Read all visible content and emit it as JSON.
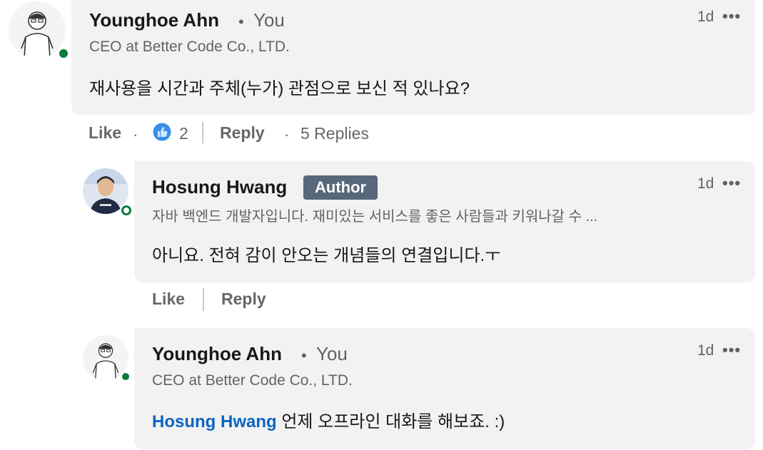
{
  "comment": {
    "author_name": "Younghoe Ahn",
    "you_label": "You",
    "headline": "CEO at Better Code Co., LTD.",
    "text": "재사용을 시간과 주체(누가) 관점으로 보신 적 있나요?",
    "time": "1d",
    "more": "•••",
    "actions": {
      "like": "Like",
      "reaction_count": "2",
      "reply": "Reply",
      "replies_count": "5 Replies"
    }
  },
  "reply1": {
    "author_name": "Hosung Hwang",
    "badge": "Author",
    "headline": "자바 백엔드 개발자입니다. 재미있는 서비스를 좋은 사람들과 키워나갈 수 ...",
    "text": "아니요. 전혀 감이 안오는 개념들의 연결입니다.ㅜ",
    "time": "1d",
    "more": "•••",
    "actions": {
      "like": "Like",
      "reply": "Reply"
    }
  },
  "reply2": {
    "author_name": "Younghoe Ahn",
    "you_label": "You",
    "headline": "CEO at Better Code Co., LTD.",
    "mention": "Hosung Hwang",
    "text": " 언제 오프라인 대화를 해보죠. :)",
    "time": "1d",
    "more": "•••"
  },
  "colors": {
    "bubble": "#f2f2f2",
    "presence": "#0a7b3e",
    "badge": "#56687a",
    "mention": "#0a66c2",
    "like_icon": "#378fe9"
  },
  "icons": [
    "sketch-avatar",
    "presence-dot",
    "thumbs-up-reaction-icon",
    "more-options-icon"
  ]
}
